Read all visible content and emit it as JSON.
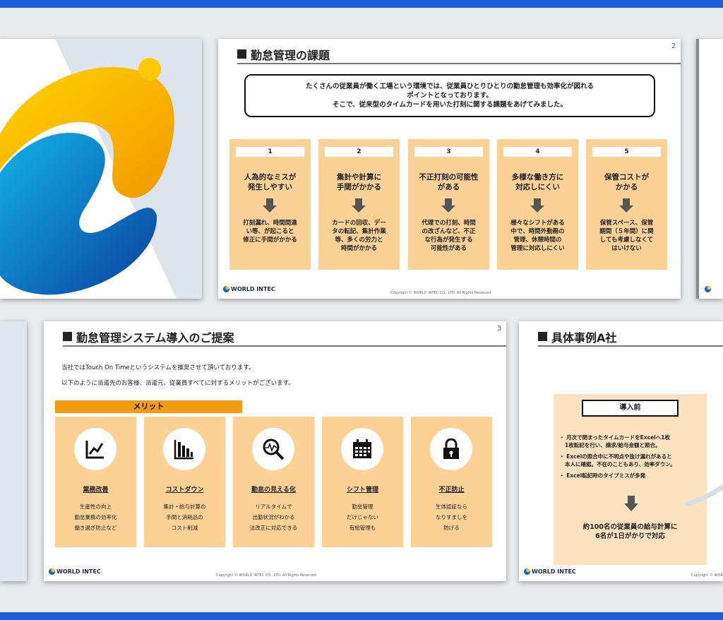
{
  "slide2": {
    "title": "勤怠管理の課題",
    "page": "2",
    "intro": [
      "たくさんの従業員が働く工場という環境では、従業員ひとりひとりの勤怠管理も効率化が図れる",
      "ポイントとなっております。",
      "そこで、従来型のタイムカードを用いた打刻に関する課題をあげてみました。"
    ],
    "issues": [
      {
        "num": "1",
        "title": [
          "人為的なミスが",
          "発生しやすい"
        ],
        "desc": [
          "打刻漏れ、時間間違",
          "い等、が起こると",
          "修正に手間がかかる"
        ]
      },
      {
        "num": "2",
        "title": [
          "集計や計算に",
          "手間がかかる"
        ],
        "desc": [
          "カードの回収、デー",
          "タの転記、集計作業",
          "等、多くの労力と",
          "時間がかかる"
        ]
      },
      {
        "num": "3",
        "title": [
          "不正打刻の可能性",
          "がある"
        ],
        "desc": [
          "代理での打刻、時間",
          "の改ざんなど、不正",
          "な行為が発生する",
          "可能性がある"
        ]
      },
      {
        "num": "4",
        "title": [
          "多様な働き方に",
          "対応しにくい"
        ],
        "desc": [
          "様々なシフトがある",
          "中で、時間外勤務の",
          "管理、休憩時間の",
          "管理に対応しにくい"
        ]
      },
      {
        "num": "5",
        "title": [
          "保管コストが",
          "かかる"
        ],
        "desc": [
          "保管スペース、保管",
          "期間（５年間）に関",
          "しても考慮しなくて",
          "はいけない"
        ]
      }
    ]
  },
  "slide3": {
    "title": "勤怠管理システム導入のご提案",
    "page": "3",
    "intro1": "当社ではTouch On Timeというシステムを推奨させて頂いております。",
    "intro2": "以下のように派遣先のお客様、派遣元、従業員すべてに対するメリットがございます。",
    "merit_label": "メリット",
    "merits": [
      {
        "icon": "chart-icon",
        "title": "業務改善",
        "desc": [
          "生産性の向上",
          "勤怠業務の効率化",
          "働き過ぎ防止など"
        ]
      },
      {
        "icon": "bar-chart-icon",
        "title": "コストダウン",
        "desc": [
          "集計・給与計算の",
          "手間と消耗品の",
          "コスト削減"
        ]
      },
      {
        "icon": "magnifier-icon",
        "title": "勤怠の見える化",
        "desc": [
          "リアルタイムで",
          "出勤状況がわかる",
          "法改正に対応できる"
        ]
      },
      {
        "icon": "calendar-icon",
        "title": "シフト管理",
        "desc": [
          "勤怠管理",
          "だけじゃない",
          "有給管理も"
        ]
      },
      {
        "icon": "lock-icon",
        "title": "不正防止",
        "desc": [
          "生体認証なら",
          "なりすましを",
          "防げる"
        ]
      }
    ]
  },
  "slide4": {
    "title": "具体事例A社",
    "before_label": "導入前",
    "bullets": [
      [
        "・ 月次で閉まったタイムカードをExcelへ1枚",
        "1枚転記を行い、請求/給与金額と照合。"
      ],
      [
        "・ Excelの照合中に不明点や抜け漏れがあると",
        "本人に確認。不在のこともあり、効率ダウン。"
      ],
      [
        "・ Excel転記時のタイプミスが多発"
      ]
    ],
    "result": [
      "約100名の従業員の給与計算に",
      "6名が1日がかりで対応"
    ]
  },
  "footer": {
    "logo_text": "WORLD INTEC",
    "copyright": "Copyright © WORLD INTEC CO., LTD. All Rights Reserved"
  },
  "colors": {
    "card": "#fcd195",
    "merit_bar": "#f39c12",
    "bar_blue": "#1d5fd9"
  }
}
